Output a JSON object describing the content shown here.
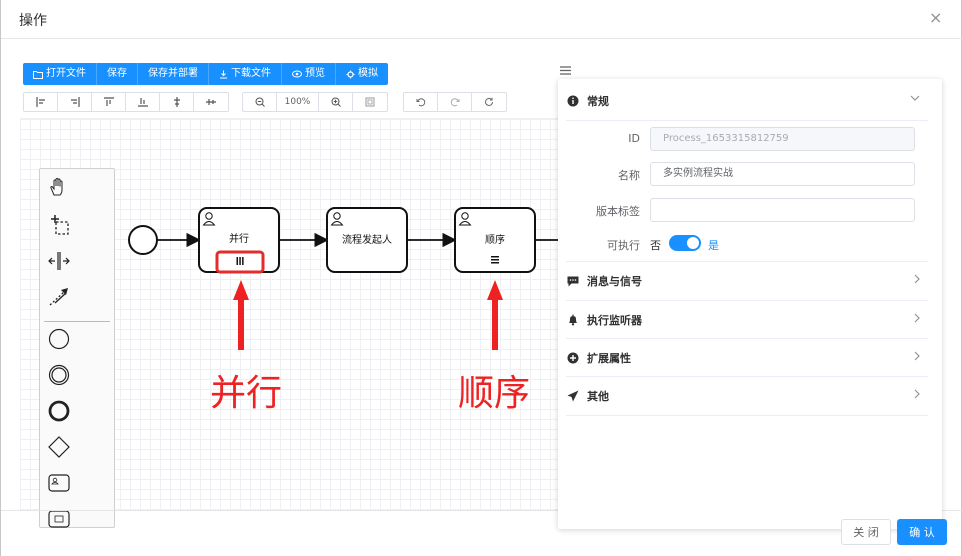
{
  "dialog": {
    "title": "操作",
    "close_symbol": "×"
  },
  "toolbar": {
    "buttons": [
      {
        "icon": "folder-open-icon",
        "label": "打开文件"
      },
      {
        "icon": "",
        "label": "保存"
      },
      {
        "icon": "",
        "label": "保存并部署"
      },
      {
        "icon": "download-icon",
        "label": "下载文件"
      },
      {
        "icon": "eye-icon",
        "label": "预览"
      },
      {
        "icon": "bug-icon",
        "label": "模拟"
      }
    ],
    "align_tools": [
      "align-left-icon",
      "align-right-icon",
      "align-top-icon",
      "align-bottom-icon",
      "align-center-icon",
      "align-middle-icon"
    ],
    "zoom": {
      "zoom_out": "zoom-out-icon",
      "value": "100%",
      "zoom_in": "zoom-in-icon",
      "fit": "fit-view-icon"
    },
    "history": [
      "undo-icon",
      "redo-icon",
      "reset-icon"
    ]
  },
  "diagram": {
    "tasks": [
      {
        "label": "并行",
        "marker": "parallel"
      },
      {
        "label": "流程发起人",
        "marker": ""
      },
      {
        "label": "顺序",
        "marker": "sequential"
      }
    ]
  },
  "annotations": {
    "parallel": "并行",
    "sequential": "顺序"
  },
  "panel": {
    "general": {
      "title": "常规",
      "id_label": "ID",
      "id_value": "Process_1653315812759",
      "name_label": "名称",
      "name_value": "多实例流程实战",
      "version_label": "版本标签",
      "version_value": "",
      "exec_label": "可执行",
      "exec_no": "否",
      "exec_yes": "是"
    },
    "sections": [
      "消息与信号",
      "执行监听器",
      "扩展属性",
      "其他"
    ]
  },
  "footer": {
    "close": "关 闭",
    "ok": "确 认"
  },
  "colors": {
    "primary": "#1890ff",
    "annotation": "#ee2222"
  }
}
